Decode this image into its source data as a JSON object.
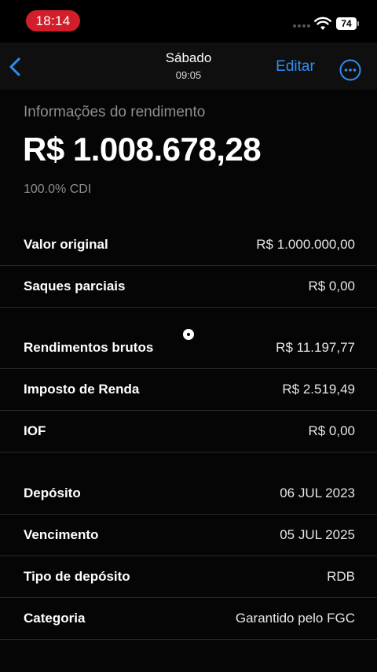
{
  "status_bar": {
    "time": "18:14",
    "battery": "74"
  },
  "nav": {
    "title": "Sábado",
    "subtitle": "09:05",
    "edit_label": "Editar"
  },
  "summary": {
    "section_label": "Informações do rendimento",
    "amount": "R$ 1.008.678,28",
    "rate": "100.0% CDI"
  },
  "rows": [
    {
      "label": "Valor original",
      "value": "R$ 1.000.000,00"
    },
    {
      "label": "Saques parciais",
      "value": "R$ 0,00"
    },
    {
      "label": "Rendimentos brutos",
      "value": "R$ 11.197,77"
    },
    {
      "label": "Imposto de Renda",
      "value": "R$ 2.519,49"
    },
    {
      "label": "IOF",
      "value": "R$ 0,00"
    },
    {
      "label": "Depósito",
      "value": "06 JUL 2023"
    },
    {
      "label": "Vencimento",
      "value": "05 JUL 2025"
    },
    {
      "label": "Tipo de depósito",
      "value": "RDB"
    },
    {
      "label": "Categoria",
      "value": "Garantido pelo FGC"
    }
  ],
  "colors": {
    "accent": "#2f8ef5",
    "time_pill": "#d21e2a",
    "background": "#000000",
    "secondary_text": "#8e8e93"
  }
}
